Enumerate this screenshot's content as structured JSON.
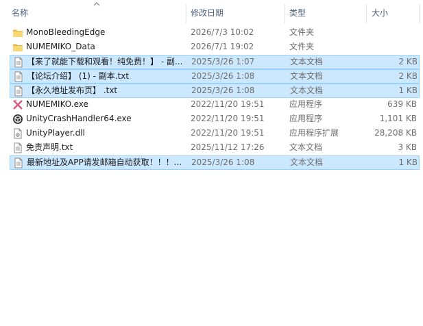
{
  "columns": {
    "name": "名称",
    "date": "修改日期",
    "type": "类型",
    "size": "大小"
  },
  "files": [
    {
      "name": "MonoBleedingEdge",
      "date": "2026/7/3 10:02",
      "type": "文件夹",
      "size": "",
      "icon": "folder-icon",
      "selected": false
    },
    {
      "name": "NUMEMIKO_Data",
      "date": "2026/7/1 19:02",
      "type": "文件夹",
      "size": "",
      "icon": "folder-icon",
      "selected": false
    },
    {
      "name": "【来了就能下载和观看！纯免费！】 - 副...",
      "date": "2025/3/26 1:07",
      "type": "文本文档",
      "size": "2 KB",
      "icon": "text-file-icon",
      "selected": true
    },
    {
      "name": "【论坛介绍】 (1) - 副本.txt",
      "date": "2025/3/26 1:08",
      "type": "文本文档",
      "size": "2 KB",
      "icon": "text-file-icon",
      "selected": true
    },
    {
      "name": "【永久地址发布页】 .txt",
      "date": "2025/3/26 1:08",
      "type": "文本文档",
      "size": "1 KB",
      "icon": "text-file-icon",
      "selected": true
    },
    {
      "name": "NUMEMIKO.exe",
      "date": "2022/11/20 19:51",
      "type": "应用程序",
      "size": "639 KB",
      "icon": "app-exe-icon",
      "selected": false
    },
    {
      "name": "UnityCrashHandler64.exe",
      "date": "2022/11/20 19:51",
      "type": "应用程序",
      "size": "1,101 KB",
      "icon": "unity-icon",
      "selected": false
    },
    {
      "name": "UnityPlayer.dll",
      "date": "2022/11/20 19:51",
      "type": "应用程序扩展",
      "size": "28,208 KB",
      "icon": "dll-file-icon",
      "selected": false
    },
    {
      "name": "免责声明.txt",
      "date": "2025/11/12 17:26",
      "type": "文本文档",
      "size": "3 KB",
      "icon": "text-file-icon",
      "selected": false
    },
    {
      "name": "最新地址及APP请发邮箱自动获取！！！...",
      "date": "2025/3/26 1:08",
      "type": "文本文档",
      "size": "1 KB",
      "icon": "text-file-icon",
      "selected": true
    }
  ],
  "colors": {
    "selection_bg": "#cce8ff",
    "selection_border": "#99d1ff",
    "folder": "#f8d775",
    "header_text": "#4c607a"
  }
}
